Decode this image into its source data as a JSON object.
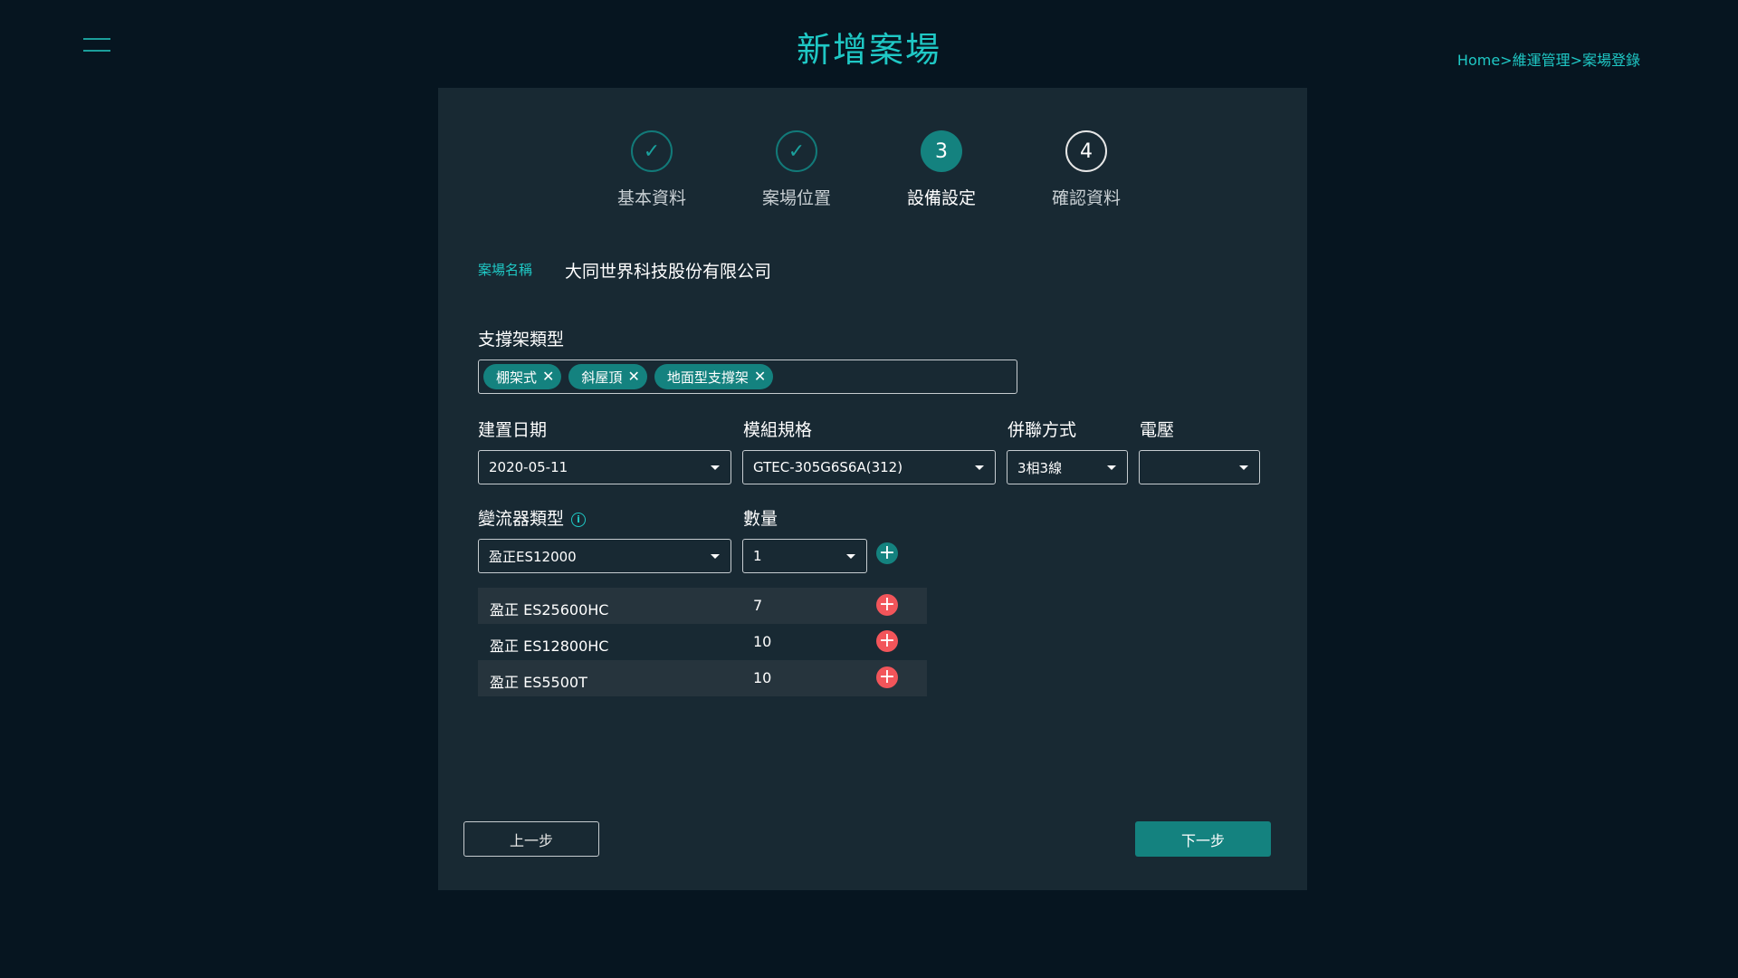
{
  "header": {
    "title": "新增案場",
    "menu_icon": "hamburger-icon",
    "breadcrumb": [
      "Home",
      ">",
      "維運管理",
      ">",
      "案場登錄"
    ]
  },
  "stepper": {
    "steps": [
      {
        "marker": "✓",
        "label": "基本資料",
        "state": "done"
      },
      {
        "marker": "✓",
        "label": "案場位置",
        "state": "done"
      },
      {
        "marker": "3",
        "label": "設備設定",
        "state": "active"
      },
      {
        "marker": "4",
        "label": "確認資料",
        "state": "pending"
      }
    ]
  },
  "site": {
    "label": "案場名稱",
    "value": "大同世界科技股份有限公司"
  },
  "mount_type": {
    "label": "支撐架類型",
    "tags": [
      "棚架式",
      "斜屋頂",
      "地面型支撐架"
    ],
    "remove_glyph": "✕"
  },
  "fields": {
    "build_date": {
      "label": "建置日期",
      "value": "2020-05-11"
    },
    "module_spec": {
      "label": "模組規格",
      "value": "GTEC-305G6S6A(312)"
    },
    "connection": {
      "label": "併聯方式",
      "value": "3相3線"
    },
    "voltage": {
      "label": "電壓",
      "value": ""
    },
    "inverter_type": {
      "label": "變流器類型",
      "value": "盈正ES12000",
      "info_glyph": "i"
    },
    "quantity": {
      "label": "數量",
      "value": "1"
    }
  },
  "inverters": [
    {
      "name": "盈正 ES25600HC",
      "qty": "7"
    },
    {
      "name": "盈正 ES12800HC",
      "qty": "10"
    },
    {
      "name": "盈正 ES5500T",
      "qty": "10"
    }
  ],
  "glyphs": {
    "plus": "+"
  },
  "colors": {
    "background": "#061520",
    "panel": "#182933",
    "accent": "#1fc8c5",
    "primary_button": "#14827f",
    "remove": "#f2555a"
  },
  "actions": {
    "prev_label": "上一步",
    "next_label": "下一步"
  }
}
